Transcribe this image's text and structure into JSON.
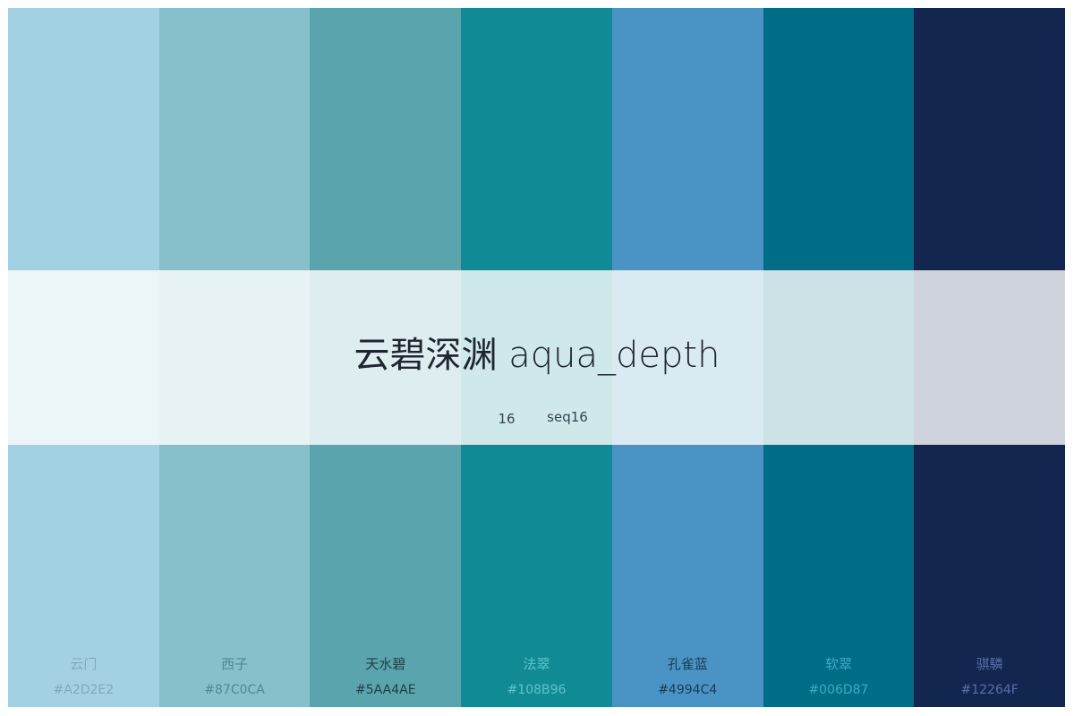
{
  "title": "云碧深渊 aqua_depth",
  "count": "16",
  "scheme": "seq16",
  "swatches": [
    {
      "name": "云门",
      "hex": "#A2D2E2",
      "color": "#A2D2E2",
      "text_color": "#7fa9ba"
    },
    {
      "name": "西子",
      "hex": "#87C0CA",
      "color": "#87C0CA",
      "text_color": "#4f8994"
    },
    {
      "name": "天水碧",
      "hex": "#5AA4AE",
      "color": "#5AA4AE",
      "text_color": "#1f3e45"
    },
    {
      "name": "法翠",
      "hex": "#108B96",
      "color": "#108B96",
      "text_color": "#5fc3cb"
    },
    {
      "name": "孔雀蓝",
      "hex": "#4994C4",
      "color": "#4994C4",
      "text_color": "#1b3a56"
    },
    {
      "name": "软翠",
      "hex": "#006D87",
      "color": "#006D87",
      "text_color": "#3fa9c0"
    },
    {
      "name": "骐驎",
      "hex": "#12264F",
      "color": "#12264F",
      "text_color": "#5a6fa5"
    }
  ]
}
